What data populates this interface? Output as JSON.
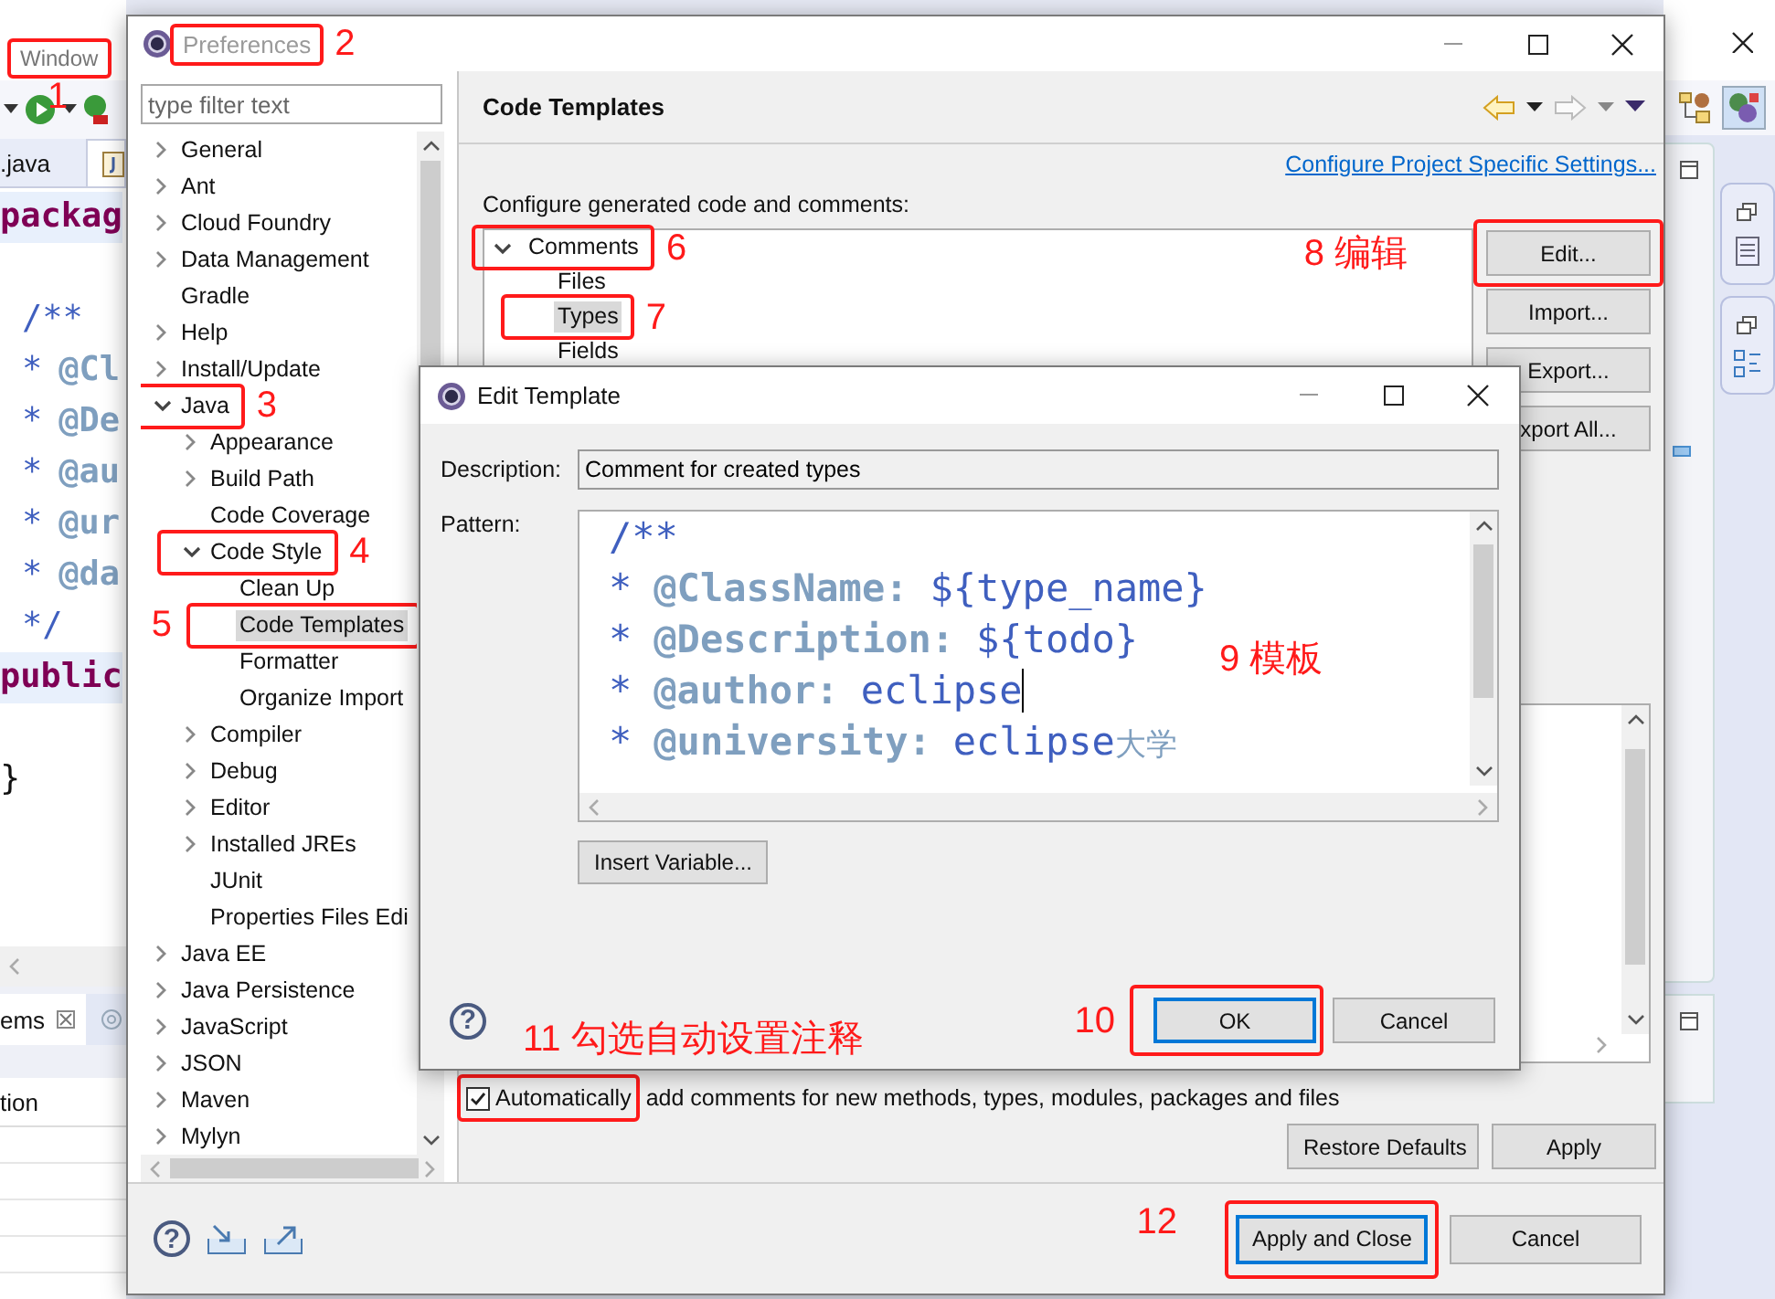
{
  "ide": {
    "menu": [
      {
        "label": "Window",
        "callout": {
          "label": "1"
        }
      }
    ],
    "editor_tabs": [
      {
        "label": ".java"
      }
    ],
    "code_lines": [
      {
        "kind": "keyword",
        "text": "packag"
      },
      {
        "kind": "comment",
        "text": "/**",
        "gap_before": true
      },
      {
        "kind": "tag",
        "star": "*",
        "tag": "@Cl"
      },
      {
        "kind": "tag",
        "star": "*",
        "tag": "@De"
      },
      {
        "kind": "tag",
        "star": "*",
        "tag": "@au"
      },
      {
        "kind": "tag",
        "star": "*",
        "tag": "@ur"
      },
      {
        "kind": "tag",
        "star": "*",
        "tag": "@da"
      },
      {
        "kind": "comment",
        "text": "*/"
      },
      {
        "kind": "keyword",
        "text": "public"
      },
      {
        "kind": "plain",
        "text": "}",
        "gap_before": true
      }
    ],
    "bottom_tab": "ems",
    "table_header": "tion"
  },
  "preferences": {
    "title": "Preferences",
    "active": false,
    "callout": {
      "label": "2"
    },
    "filter_placeholder": "type filter text",
    "tree": [
      {
        "label": "General",
        "expanded": false,
        "selected": false
      },
      {
        "label": "Ant",
        "expanded": false,
        "selected": false
      },
      {
        "label": "Cloud Foundry",
        "expanded": false,
        "selected": false
      },
      {
        "label": "Data Management",
        "expanded": false,
        "selected": false
      },
      {
        "label": "Gradle",
        "selected": false
      },
      {
        "label": "Help",
        "expanded": false,
        "selected": false
      },
      {
        "label": "Install/Update",
        "expanded": false,
        "selected": false
      },
      {
        "label": "Java",
        "expanded": true,
        "selected": false,
        "callout": {
          "label": "3"
        },
        "children": [
          {
            "label": "Appearance",
            "expanded": false,
            "selected": false
          },
          {
            "label": "Build Path",
            "expanded": false,
            "selected": false
          },
          {
            "label": "Code Coverage",
            "selected": false
          },
          {
            "label": "Code Style",
            "expanded": true,
            "selected": false,
            "callout": {
              "label": "4"
            },
            "children": [
              {
                "label": "Clean Up",
                "selected": false
              },
              {
                "label": "Code Templates",
                "selected": true,
                "callout": {
                  "label": "5"
                }
              },
              {
                "label": "Formatter",
                "selected": false
              },
              {
                "label": "Organize Import",
                "selected": false
              }
            ]
          },
          {
            "label": "Compiler",
            "expanded": false,
            "selected": false
          },
          {
            "label": "Debug",
            "expanded": false,
            "selected": false
          },
          {
            "label": "Editor",
            "expanded": false,
            "selected": false
          },
          {
            "label": "Installed JREs",
            "expanded": false,
            "selected": false
          },
          {
            "label": "JUnit",
            "selected": false
          },
          {
            "label": "Properties Files Edi",
            "selected": false
          }
        ]
      },
      {
        "label": "Java EE",
        "expanded": false,
        "selected": false
      },
      {
        "label": "Java Persistence",
        "expanded": false,
        "selected": false
      },
      {
        "label": "JavaScript",
        "expanded": false,
        "selected": false
      },
      {
        "label": "JSON",
        "expanded": false,
        "selected": false
      },
      {
        "label": "Maven",
        "expanded": false,
        "selected": false
      },
      {
        "label": "Mylyn",
        "expanded": false,
        "selected": false
      }
    ],
    "page_title": "Code Templates",
    "link": "Configure Project Specific Settings...",
    "intro": "Configure generated code and comments:",
    "templates": [
      {
        "label": "Comments",
        "expanded": true,
        "selected": false,
        "callout": {
          "label": "6"
        },
        "children": [
          {
            "label": "Files",
            "selected": false
          },
          {
            "label": "Types",
            "selected": true,
            "callout": {
              "label": "7"
            }
          },
          {
            "label": "Fields",
            "selected": false
          }
        ]
      }
    ],
    "side_buttons": [
      {
        "label": "Edit...",
        "callout": {
          "label": "8 编辑"
        }
      },
      {
        "label": "Import..."
      },
      {
        "label": "Export..."
      },
      {
        "label": "xport All..."
      }
    ],
    "auto_comments": {
      "checked": true,
      "label": "Automatically",
      "label_rest": "add comments for new methods, types, modules, packages and files",
      "callout": {
        "label": "11 勾选自动设置注释"
      }
    },
    "page_buttons": [
      "Restore Defaults",
      "Apply"
    ],
    "help": "?",
    "footer_buttons": [
      {
        "label": "Apply and Close",
        "default": true,
        "callout": {
          "label": "12"
        }
      },
      {
        "label": "Cancel",
        "default": false
      }
    ]
  },
  "edit_template": {
    "title": "Edit Template",
    "active": true,
    "description_label": "Description:",
    "description": "Comment for created types",
    "pattern_label": "Pattern:",
    "pattern_lines": [
      {
        "kind": "open",
        "text": "/**"
      },
      {
        "kind": "tag",
        "star": "*",
        "tag": "@ClassName:",
        "value": "${type_name}"
      },
      {
        "kind": "tag",
        "star": "*",
        "tag": "@Description:",
        "value": "${todo}"
      },
      {
        "kind": "tag",
        "star": "*",
        "tag": "@author:",
        "value": "eclipse",
        "caret": true
      },
      {
        "kind": "tag",
        "star": "*",
        "tag": "@university:",
        "value": "eclipse",
        "value_cjk": "大学"
      }
    ],
    "pattern_callout": {
      "label": "9 模板"
    },
    "insert_button": "Insert Variable...",
    "help": "?",
    "buttons": [
      {
        "label": "OK",
        "default": true,
        "callout": {
          "label": "10"
        }
      },
      {
        "label": "Cancel",
        "default": false
      }
    ]
  }
}
